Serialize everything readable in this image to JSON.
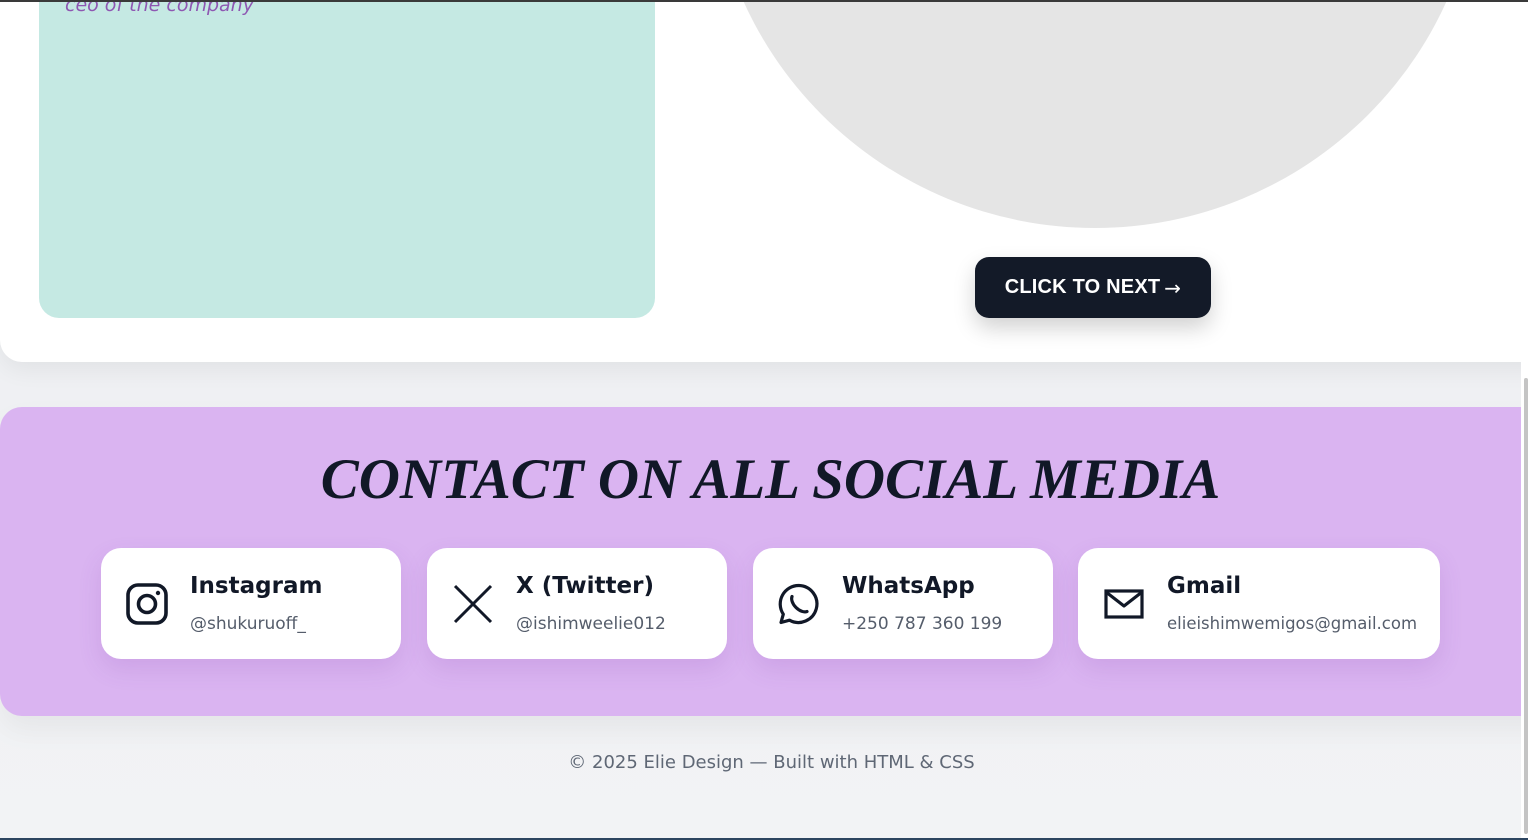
{
  "hero": {
    "caption": "ceo of the company",
    "next_button": {
      "label": "CLICK TO NEXT",
      "arrow": "→"
    }
  },
  "contact": {
    "title": "CONTACT ON ALL SOCIAL MEDIA",
    "cards": [
      {
        "name": "Instagram",
        "handle": "@shukuruoff_",
        "icon": "instagram-icon"
      },
      {
        "name": "X (Twitter)",
        "handle": "@ishimweelie012",
        "icon": "x-icon"
      },
      {
        "name": "WhatsApp",
        "handle": "+250 787 360 199",
        "icon": "whatsapp-icon"
      },
      {
        "name": "Gmail",
        "handle": "elieishimwemigos@gmail.com",
        "icon": "mail-icon"
      }
    ]
  },
  "footer": {
    "text": "© 2025 Elie Design — Built with HTML & CSS"
  },
  "colors": {
    "accent_dark": "#131a28",
    "mint_panel": "#c5e9e3",
    "contact_bg": "#dab4f1",
    "caption_purple": "#8e57b2"
  }
}
